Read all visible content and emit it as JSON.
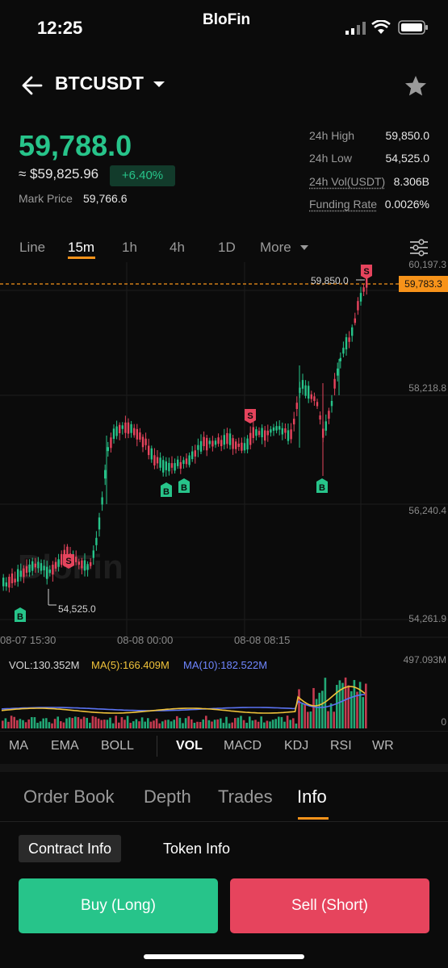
{
  "status_bar": {
    "time": "12:25",
    "brand": "BloFin"
  },
  "header": {
    "pair": "BTCUSDT"
  },
  "ticker": {
    "last_price": "59,788.0",
    "usd_price": "≈ $59,825.96",
    "change": "+6.40%",
    "mark_label": "Mark Price",
    "mark_value": "59,766.6"
  },
  "stats": [
    {
      "label": "24h High",
      "value": "59,850.0"
    },
    {
      "label": "24h Low",
      "value": "54,525.0"
    },
    {
      "label": "24h Vol(USDT)",
      "value": "8.306B"
    },
    {
      "label": "Funding Rate",
      "value": "0.0026%"
    }
  ],
  "timeframes": [
    "Line",
    "15m",
    "1h",
    "4h",
    "1D",
    "More"
  ],
  "active_timeframe": "15m",
  "chart": {
    "price_axis": [
      "60,197.3",
      "58,218.8",
      "56,240.4",
      "54,261.9"
    ],
    "current_price_tag": "59,783.3",
    "high_marker": "59,850.0",
    "low_marker": "54,525.0",
    "time_axis": [
      "08-07 15:30",
      "08-08 00:00",
      "08-08 08:15"
    ],
    "volume_axis": [
      "497.093M",
      "0"
    ],
    "vol_legend": {
      "vol": "VOL:130.352M",
      "ma5": "MA(5):166.409M",
      "ma10": "MA(10):182.522M"
    },
    "buy_marker": "B",
    "sell_marker": "S",
    "watermark": "BloFin"
  },
  "colors": {
    "up": "#27c48a",
    "down": "#e6445d",
    "accent": "#f7931a",
    "ma5": "#f0c23a",
    "ma10": "#5b73f2"
  },
  "indicators": [
    "MA",
    "EMA",
    "BOLL",
    "VOL",
    "MACD",
    "KDJ",
    "RSI",
    "WR"
  ],
  "active_indicator": "VOL",
  "bottom_tabs": [
    "Order Book",
    "Depth",
    "Trades",
    "Info"
  ],
  "active_bottom_tab": "Info",
  "sub_tabs": [
    "Contract Info",
    "Token Info"
  ],
  "actions": {
    "buy": "Buy (Long)",
    "sell": "Sell (Short)"
  }
}
